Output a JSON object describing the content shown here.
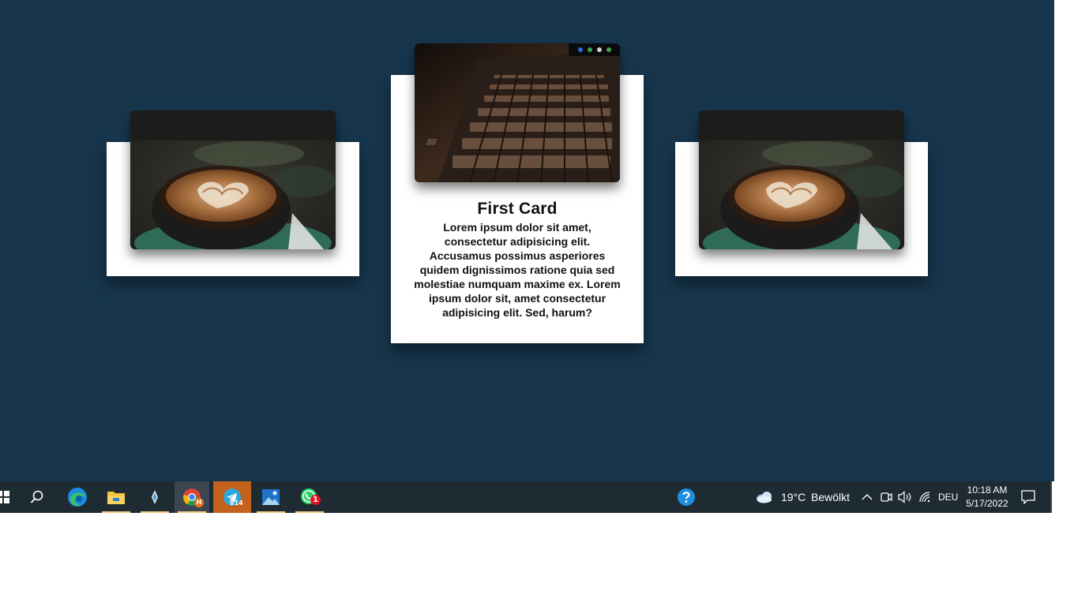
{
  "cards": {
    "center": {
      "title": "First Card",
      "text": "Lorem ipsum dolor sit amet, consectetur adipisicing elit. Accusamus possimus asperiores quidem dignissimos ratione quia sed molestiae numquam maxime ex. Lorem ipsum dolor sit, amet consectetur adipisicing elit. Sed, harum?"
    }
  },
  "taskbar": {
    "telegram_badge": "814",
    "whatsapp_badge": "1",
    "chrome_badge": "H",
    "weather_temp": "19°C",
    "weather_desc": "Bewölkt",
    "language": "DEU",
    "time": "10:18 AM",
    "date": "5/17/2022"
  },
  "colors": {
    "background": "#17364d",
    "taskbar": "#1f2b33",
    "telegram_highlight": "#c4611b"
  },
  "icons": [
    "windows-start-icon",
    "search-icon",
    "edge-icon",
    "file-explorer-icon",
    "app-icon",
    "chrome-icon",
    "telegram-icon",
    "photos-icon",
    "whatsapp-icon",
    "help-icon",
    "weather-icon",
    "chevron-up-icon",
    "meet-now-icon",
    "volume-icon",
    "wifi-icon",
    "notification-icon"
  ]
}
